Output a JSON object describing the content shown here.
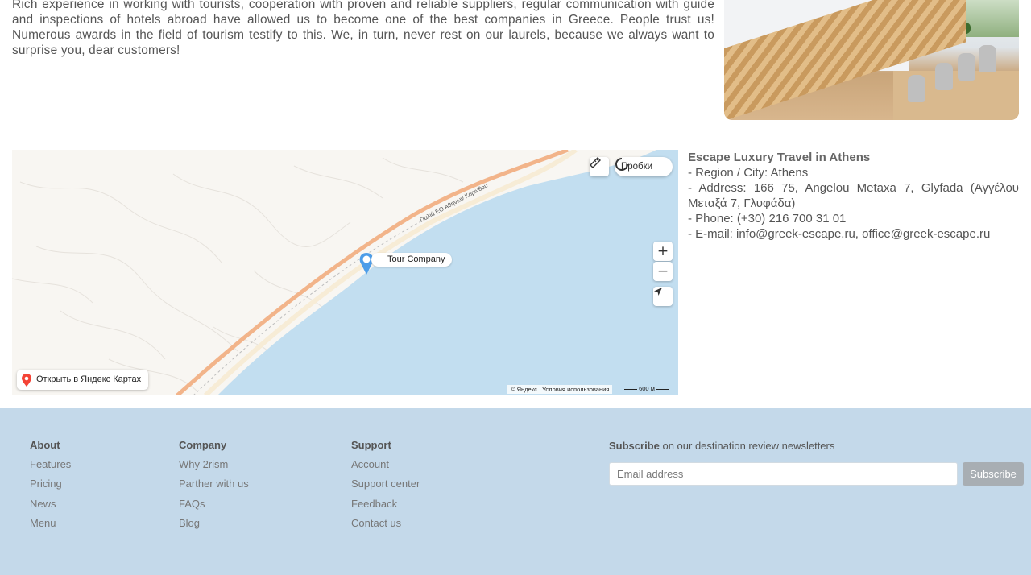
{
  "intro": {
    "text": "Rich experience in working with tourists, cooperation with proven and reliable suppliers, regular communication with guide and inspections of hotels abroad have allowed us to become one of the best companies in Greece. People trust us! Numerous awards in the field of tourism testify to this. We, in turn, never rest on our laurels, because we always want to surprise you, dear customers!"
  },
  "map": {
    "traffic_label": "Пробки",
    "pin_label": "Tour Company",
    "road_label": "Παλιά ΕΟ Αθηνών Κορίνθου",
    "open_label": "Открыть в Яндекс Картах",
    "copyright": "© Яндекс",
    "terms": "Условия использования",
    "scale_label": "600 м",
    "zoom_in": "+",
    "zoom_out": "−",
    "colors": {
      "sea": "#c2def0",
      "land": "#f8f6f2",
      "road": "#f2b48a",
      "pin": "#4d9de8"
    }
  },
  "contact": {
    "title": "Escape Luxury Travel in Athens",
    "region": "- Region / City: Athens",
    "address": "- Address: 166 75, Angelou Metaxa 7, Glyfada (Αγγέλου Μεταξά 7, Γλυφάδα)",
    "phone": "- Phone: (+30) 216 700 31 01",
    "email": "- E-mail: info@greek-escape.ru, office@greek-escape.ru"
  },
  "footer": {
    "columns": [
      {
        "title": "About",
        "links": [
          "Features",
          "Pricing",
          "News",
          "Menu"
        ]
      },
      {
        "title": "Company",
        "links": [
          "Why 2rism",
          "Parther with us",
          "FAQs",
          "Blog"
        ]
      },
      {
        "title": "Support",
        "links": [
          "Account",
          "Support center",
          "Feedback",
          "Contact us"
        ]
      }
    ],
    "subscribe_bold": "Subscribe",
    "subscribe_text": " on our destination review newsletters",
    "email_placeholder": "Email address",
    "subscribe_button": "Subscribe",
    "background": "#c4d9ea"
  }
}
